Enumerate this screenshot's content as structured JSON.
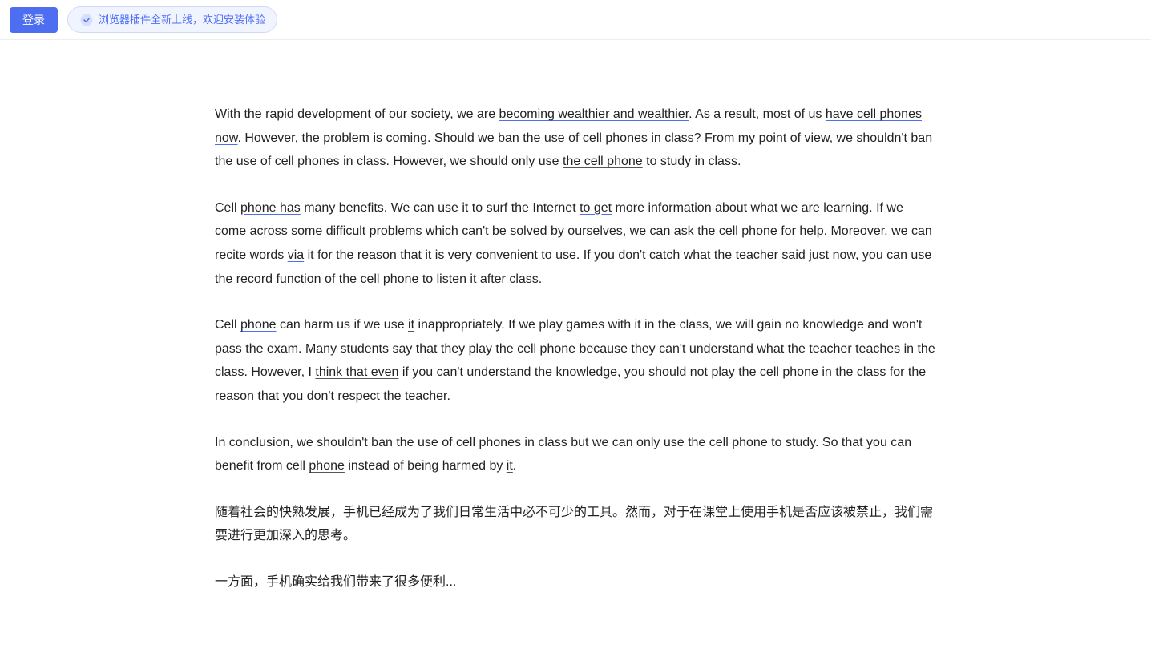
{
  "topbar": {
    "login_label": "登录",
    "plugin_text": "浏览器插件全新上线，欢迎安装体验"
  },
  "article": {
    "paragraph1": {
      "text": "With the rapid development of our society, we are becoming wealthier and wealthier. As a result, most of us have cell phones now. However, the problem is coming. Should we ban the use of cell phones in class? From my point of view, we shouldn’t ban the use of cell phones in class. However, we should only use the cell phone to study in class.",
      "underline_words": [
        "becoming wealthier and wealthier",
        "have cell phones now",
        "the cell phone"
      ]
    },
    "paragraph2": {
      "text": "Cell phone has many benefits. We can use it to surf the Internet to get more information about what we are learning. If we come across some difficult problems which can’t be solved by ourselves, we can ask the cell phone for help. Moreover, we can recite words via it for the reason that it is very convenient to use. If you don’t catch what the teacher said just now, you can use the record function of the cell phone to listen it after class.",
      "underline_words": [
        "phone has",
        "to get",
        "via"
      ]
    },
    "paragraph3": {
      "text": "Cell phone can harm us if we use it inappropriately. If we play games with it in the class, we will gain no knowledge and won’t pass the exam. Many students say that they play the cell phone because they can’t understand what the teacher teaches in the class. However, I think that even if you can’t understand the knowledge, you should not play the cell phone in the class for the reason that you don’t respect the teacher.",
      "underline_words": [
        "phone",
        "it",
        "think that even"
      ]
    },
    "paragraph4": {
      "text": "In conclusion, we shouldn’t ban the use of cell phones in class but we can only use the cell phone to study. So that you can benefit from cell phone instead of being harmed by it.",
      "underline_words": [
        "phone",
        "it"
      ]
    },
    "paragraph5_chinese": "随着社会的快熟发展，手机已经成为了我们日常生活中必不可少的工具。然而，对于在课堂上使用手机是否应该被禁止，我们需要进行更加深入的思考。",
    "paragraph6_partial": "一方面，手机确实给我们带来了很多便利..."
  }
}
